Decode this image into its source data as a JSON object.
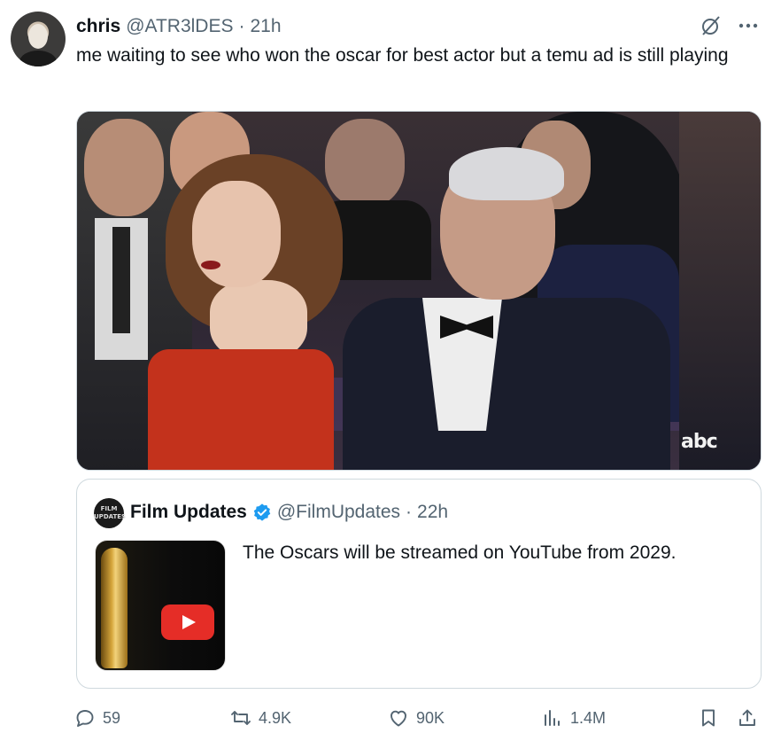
{
  "tweet": {
    "author_name": "chris",
    "author_handle": "@ATR3lDES",
    "separator": "·",
    "time": "21h",
    "text": "me waiting to see who won the oscar for best actor but a temu ad is still playing",
    "media": {
      "watermark": "abc"
    }
  },
  "quoted_tweet": {
    "avatar_text": "FILM UPDATES",
    "author_name": "Film Updates",
    "author_handle": "@FilmUpdates",
    "separator": "·",
    "time": "22h",
    "text": "The Oscars will be streamed on YouTube from 2029."
  },
  "actions": {
    "replies": "59",
    "reposts": "4.9K",
    "likes": "90K",
    "views": "1.4M"
  },
  "colors": {
    "text": "#0f1419",
    "secondary": "#536471",
    "border": "#cfd9de",
    "verified": "#1d9bf0",
    "youtube_red": "#e52d27"
  },
  "icons": [
    "grok-icon",
    "more-icon",
    "verified-icon",
    "reply-icon",
    "repost-icon",
    "like-icon",
    "views-icon",
    "bookmark-icon",
    "share-icon",
    "youtube-play-icon"
  ]
}
